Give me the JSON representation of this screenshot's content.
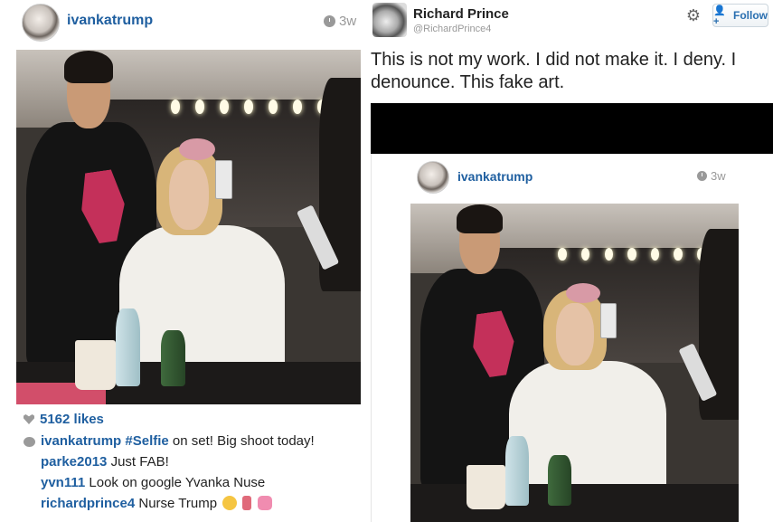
{
  "instagram_post": {
    "username": "ivankatrump",
    "time": "3w",
    "likes": "5162 likes",
    "caption": {
      "user": "ivankatrump",
      "hashtag": "#Selfie",
      "text": " on set! Big shoot today!"
    },
    "comments": [
      {
        "user": "parke2013",
        "text": " Just FAB!"
      },
      {
        "user": "yvn111",
        "text": " Look on google Yvanka Nuse"
      },
      {
        "user": "richardprince4",
        "text": " Nurse Trump"
      }
    ]
  },
  "tweet": {
    "name": "Richard Prince",
    "handle": "@RichardPrince4",
    "follow_label": "Follow",
    "text": "This is not my work. I did not make it. I deny. I denounce. This fake art."
  },
  "embedded_post": {
    "username": "ivankatrump",
    "time": "3w"
  },
  "icons": [
    "clock-icon",
    "heart-icon",
    "comment-icon",
    "gear-icon",
    "add-user-icon"
  ],
  "colors": {
    "link": "#1f5fa0",
    "muted": "#999999",
    "follow_text": "#2a6fb0",
    "black_bar": "#000000"
  }
}
